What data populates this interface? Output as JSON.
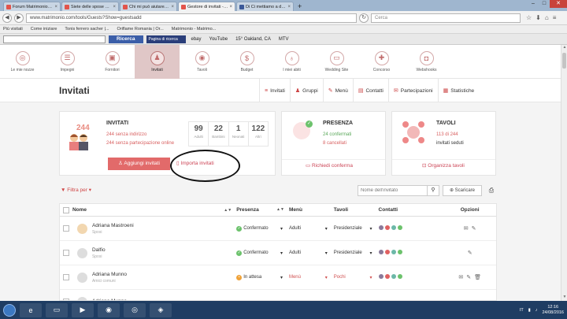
{
  "browser": {
    "tabs": [
      {
        "label": "Forum Matrimonio.com - P...",
        "color": "#e2544b"
      },
      {
        "label": "Siete delle spose alla mod...",
        "color": "#e2544b"
      },
      {
        "label": "Chi mi può aiutare? - Foru...",
        "color": "#e2544b"
      },
      {
        "label": "Gestore di invitati - Matrim...",
        "color": "#e2544b",
        "active": true
      },
      {
        "label": "Di Ci mettiamo a dieta!",
        "color": "#3b5998"
      }
    ],
    "url": "www.matrimonio.com/tools/Guests?Show=guestsadd",
    "search_placeholder": "Cerca",
    "bookmarks": [
      "Più visitati",
      "Come iniziare",
      "Tonis ferrero sacher |...",
      "Oriflame Romania | Or...",
      "Matrimonio - Matrimo..."
    ],
    "toolbar2": {
      "search_button": "Ricerca",
      "weather": "15° Oakland, CA",
      "items": [
        "ebay",
        "YouTube",
        "MTV"
      ],
      "dark_box": "Pagina di ricerca"
    }
  },
  "sitenav": {
    "items": [
      {
        "label": "Le mie nozze",
        "icon": "rings-icon"
      },
      {
        "label": "Impegni",
        "icon": "checklist-icon"
      },
      {
        "label": "Fornitori",
        "icon": "vendors-icon"
      },
      {
        "label": "Invitati",
        "icon": "guests-icon",
        "active": true
      },
      {
        "label": "Tavoli",
        "icon": "table-icon"
      },
      {
        "label": "Budget",
        "icon": "budget-icon"
      },
      {
        "label": "I miei abiti",
        "icon": "dress-icon"
      },
      {
        "label": "Wedding Site",
        "icon": "website-icon"
      },
      {
        "label": "Concorso",
        "icon": "contest-icon"
      },
      {
        "label": "Webshooks",
        "icon": "camera-icon"
      }
    ]
  },
  "page": {
    "title": "Invitati",
    "tabs": [
      {
        "label": "Invitati",
        "icon": "≡"
      },
      {
        "label": "Gruppi",
        "icon": "♟"
      },
      {
        "label": "Menù",
        "icon": "✎"
      },
      {
        "label": "Contatti",
        "icon": "▤"
      },
      {
        "label": "Partecipazioni",
        "icon": "✉"
      },
      {
        "label": "Statistiche",
        "icon": "▦"
      }
    ]
  },
  "summary": {
    "invitati": {
      "count": "244",
      "heading": "INVITATI",
      "line1": "244 senza indirizzo",
      "line2": "244 senza partecipazione online",
      "stats": [
        {
          "n": "99",
          "l": "Adulti"
        },
        {
          "n": "22",
          "l": "Bambini"
        },
        {
          "n": "1",
          "l": "Neonati"
        },
        {
          "n": "122",
          "l": "Altri"
        }
      ],
      "add_button": "Aggiungi invitati",
      "import_button": "Importa invitati"
    },
    "presenza": {
      "heading": "PRESENZA",
      "line1": "24 confermati",
      "line2": "8 cancellati",
      "link": "Richiedi conferma"
    },
    "tavoli": {
      "heading": "TAVOLI",
      "line1": "113 di 244",
      "line2": "invitati seduti",
      "link": "Organizza tavoli"
    }
  },
  "filters": {
    "filter_label": "Filtra per",
    "search_placeholder": "Nome dell'invitato",
    "download_label": "Scaricare"
  },
  "table": {
    "headers": [
      "Nome",
      "Presenza",
      "Menù",
      "Tavoli",
      "Contatti",
      "Opzioni"
    ],
    "rows": [
      {
        "name": "Adriana Mastroeni",
        "role": "Sposi",
        "presenza": "Confermato",
        "status": "ok",
        "menu": "Adulti",
        "tavolo": "Presidenziale",
        "avatar": "f"
      },
      {
        "name": "Dalfio",
        "role": "Sposi",
        "presenza": "Confermato",
        "status": "ok",
        "menu": "Adulti",
        "tavolo": "Presidenziale",
        "avatar": "m"
      },
      {
        "name": "Adriana Munno",
        "role": "Amici comuni",
        "presenza": "In attesa",
        "status": "wait",
        "menu": "Menù",
        "tavolo": "Pochi",
        "avatar": "m"
      },
      {
        "name": "Adriana Munno",
        "role": "",
        "presenza": "",
        "status": "",
        "menu": "",
        "tavolo": "",
        "avatar": "m"
      }
    ]
  },
  "taskbar": {
    "lang": "IT",
    "time": "12:16",
    "date": "24/08/2016"
  },
  "colors": {
    "accent": "#e26a6a",
    "active_nav": "#e0c7c7",
    "confirmed": "#6cc26c",
    "pending": "#f0a33a"
  }
}
